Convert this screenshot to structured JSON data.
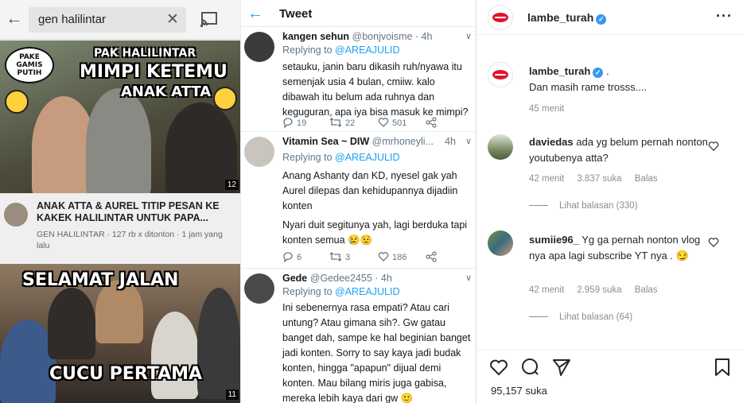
{
  "youtube": {
    "search_query": "gen halilintar",
    "back_icon": "arrow-left-icon",
    "clear_icon": "close-icon",
    "cast_icon": "cast-icon",
    "thumb1": {
      "bubble": "PAKE GAMIS PUTIH",
      "line1": "PAK HALILINTAR",
      "line2": "MIMPI KETEMU",
      "line3": "ANAK ATTA",
      "duration": "12"
    },
    "video": {
      "title": "ANAK ATTA & AUREL TITIP PESAN KE KAKEK HALILINTAR UNTUK PAPA...",
      "meta": "GEN HALILINTAR · 127 rb x ditonton · 1 jam yang lalu"
    },
    "thumb2": {
      "line1": "SELAMAT JALAN",
      "line2": "CUCU PERTAMA",
      "duration": "11"
    }
  },
  "twitter": {
    "header_title": "Tweet",
    "tweets": [
      {
        "name": "kangen sehun",
        "handle": "@bonjvoisme · 4h",
        "reply_prefix": "Replying to",
        "reply_to": "@AREAJULID",
        "text": "setauku, janin baru dikasih ruh/nyawa itu semenjak usia 4 bulan, cmiiw. kalo dibawah itu belum ada ruhnya dan keguguran, apa iya bisa masuk ke mimpi?",
        "replies": "19",
        "retweets": "22",
        "likes": "501"
      },
      {
        "name": "Vitamin Sea ~ DIW",
        "handle": "@mrhoneyli...",
        "time": "4h",
        "reply_prefix": "Replying to",
        "reply_to": "@AREAJULID",
        "text1": "Anang Ashanty dan KD, nyesel gak yah Aurel dilepas dan kehidupannya dijadiin konten",
        "text2": "Nyari duit segitunya yah, lagi berduka tapi konten semua 😢😟",
        "replies": "6",
        "retweets": "3",
        "likes": "186"
      },
      {
        "name": "Gede",
        "handle": "@Gedee2455 · 4h",
        "reply_prefix": "Replying to",
        "reply_to": "@AREAJULID",
        "text": "Ini sebenernya rasa empati? Atau cari untung? Atau gimana sih?. Gw gatau banget dah, sampe ke hal beginian banget jadi konten. Sorry to say kaya jadi budak konten, hingga \"apapun\" dijual demi konten. Mau bilang miris juga gabisa, mereka lebih kaya dari gw 🙂"
      }
    ]
  },
  "instagram": {
    "username": "lambe_turah",
    "caption_user": "lambe_turah",
    "caption_suffix": ".",
    "caption_text": "Dan masih rame trosss....",
    "caption_time": "45 menit",
    "comments": [
      {
        "user": "daviedas",
        "text": "ada yg belum pernah nonton youtubenya atta?",
        "time": "42 menit",
        "likes": "3.837 suka",
        "reply": "Balas",
        "view_replies": "Lihat balasan (330)"
      },
      {
        "user": "sumiie96_",
        "text": "Yg ga pernah nonton vlog nya apa lagi subscribe YT nya . 😏",
        "time": "42 menit",
        "likes": "2.959 suka",
        "reply": "Balas",
        "view_replies": "Lihat balasan (64)"
      }
    ],
    "likes_count": "95,157 suka",
    "accent": "#3897f0"
  }
}
